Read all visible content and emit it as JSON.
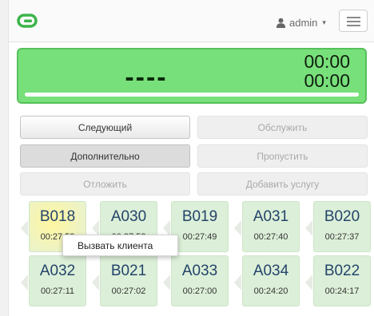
{
  "navbar": {
    "logo_icon": "link-loop-icon",
    "user": {
      "icon": "user-icon",
      "name": "admin",
      "caret": "▾"
    },
    "menu_icon": "hamburger-icon"
  },
  "display": {
    "ticket": "----",
    "timer_1": "00:00",
    "timer_2": "00:00",
    "progress_percent": 100
  },
  "buttons": {
    "next": "Следующий",
    "serve": "Обслужить",
    "additional": "Дополнительно",
    "skip": "Пропустить",
    "postpone": "Отложить",
    "add_service": "Добавить услугу"
  },
  "tickets": [
    {
      "code": "B018",
      "time": "00:27:58",
      "highlighted": true
    },
    {
      "code": "A030",
      "time": "00:27:52",
      "highlighted": false
    },
    {
      "code": "B019",
      "time": "00:27:49",
      "highlighted": false
    },
    {
      "code": "A031",
      "time": "00:27:40",
      "highlighted": false
    },
    {
      "code": "B020",
      "time": "00:27:37",
      "highlighted": false
    },
    {
      "code": "A032",
      "time": "00:27:11",
      "highlighted": false
    },
    {
      "code": "B021",
      "time": "00:27:02",
      "highlighted": false
    },
    {
      "code": "A033",
      "time": "00:27:00",
      "highlighted": false
    },
    {
      "code": "A034",
      "time": "00:24:20",
      "highlighted": false
    },
    {
      "code": "B022",
      "time": "00:24:17",
      "highlighted": false
    }
  ],
  "context_menu": {
    "call_client": "Вызвать клиента"
  },
  "colors": {
    "display_bg": "#78e07a",
    "ticket_bg": "#dcefd8",
    "ticket_code": "#24446a",
    "logo": "#3cb44a"
  }
}
